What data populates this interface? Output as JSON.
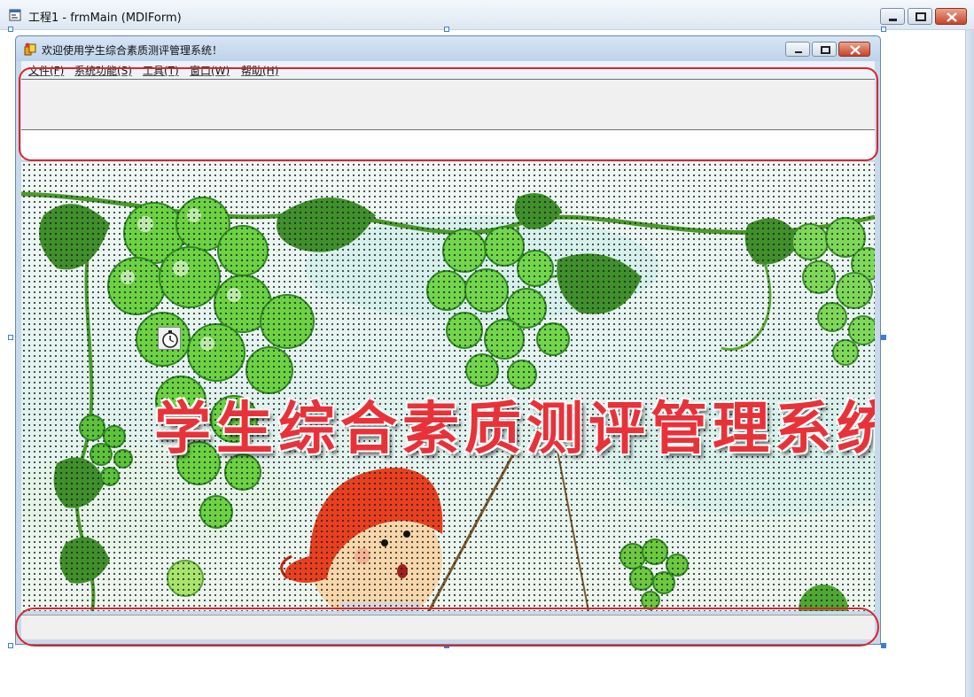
{
  "ide_window": {
    "title": "工程1 - frmMain (MDIForm)",
    "icon": "form-designer-icon"
  },
  "mdi_form": {
    "title": "欢迎使用学生综合素质测评管理系统！",
    "icon": "app-icon",
    "menus": [
      {
        "label": "文件(F)"
      },
      {
        "label": "系统功能(S)"
      },
      {
        "label": "工具(T)"
      },
      {
        "label": "窗口(W)"
      },
      {
        "label": "帮助(H)"
      }
    ]
  },
  "banner": {
    "text": "学生综合素质测评管理系统"
  },
  "controls": {
    "timer_icon": "stopwatch-icon"
  },
  "colors": {
    "annotation": "#d9252e",
    "banner_text": "#e8323a",
    "grape_green": "#5cc23a",
    "hair_red": "#e8401e"
  }
}
